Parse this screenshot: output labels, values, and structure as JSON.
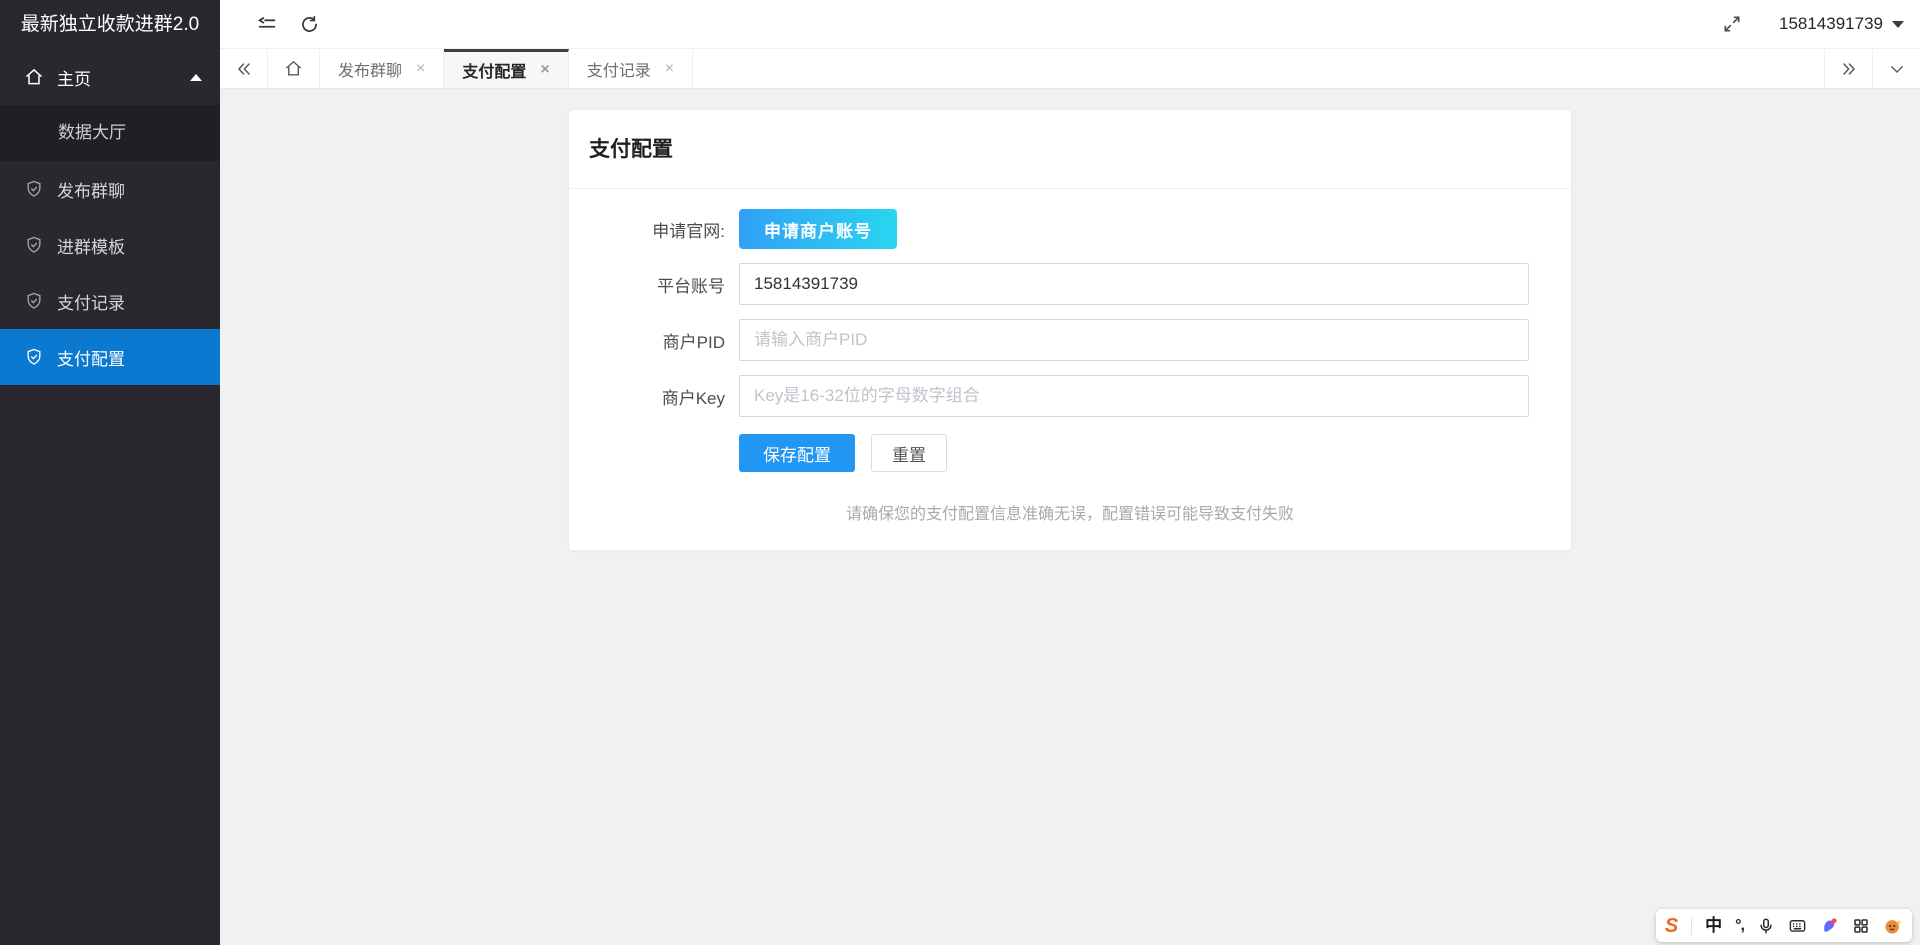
{
  "app": {
    "title": "最新独立收款进群2.0",
    "account": "15814391739"
  },
  "sidebar": {
    "items": [
      {
        "label": "主页"
      },
      {
        "label": "数据大厅"
      },
      {
        "label": "发布群聊"
      },
      {
        "label": "进群模板"
      },
      {
        "label": "支付记录"
      },
      {
        "label": "支付配置"
      }
    ],
    "active_item": "支付配置"
  },
  "tabbar": {
    "tabs": [
      {
        "label": "发布群聊"
      },
      {
        "label": "支付配置",
        "active": true
      },
      {
        "label": "支付记录"
      }
    ]
  },
  "glyphs": {
    "close": "×"
  },
  "page": {
    "card_title": "支付配置"
  },
  "form": {
    "apply_label": "申请官网:",
    "apply_button": "申请商户账号",
    "account_label": "平台账号",
    "account_value": "15814391739",
    "pid_label": "商户PID",
    "pid_placeholder": "请输入商户PID",
    "key_label": "商户Key",
    "key_placeholder": "Key是16-32位的字母数字组合",
    "save_label": "保存配置",
    "reset_label": "重置",
    "note": "请确保您的支付配置信息准确无误，配置错误可能导致支付失败"
  },
  "tray": {
    "sogou": "S",
    "chinese_mode": "中",
    "punctuation": "°,"
  },
  "colors": {
    "sidebar_bg": "#28282e",
    "sidebar_submenu_bg": "#1f1f24",
    "sidebar_active": "#0b79d0",
    "accent_button": "#2196f3",
    "apply_gradient_start": "#31a0f7",
    "apply_gradient_end": "#29d5f0",
    "content_bg": "#f1f1f2",
    "active_tab_border": "#3e3e46"
  }
}
